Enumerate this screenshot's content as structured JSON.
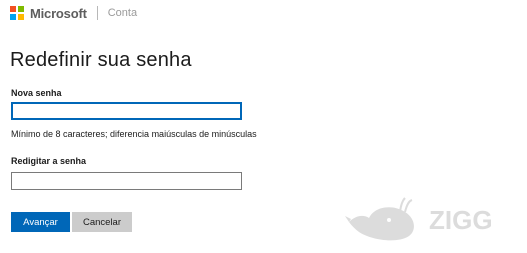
{
  "header": {
    "brand": "Microsoft",
    "section": "Conta",
    "logo_colors": [
      "#f25022",
      "#7fba00",
      "#00a4ef",
      "#ffb900"
    ]
  },
  "page": {
    "title": "Redefinir sua senha"
  },
  "form": {
    "new_password_label": "Nova senha",
    "new_password_value": "",
    "hint": "Mínimo de 8 caracteres; diferencia maiúsculas de minúsculas",
    "confirm_password_label": "Redigitar a senha",
    "confirm_password_value": ""
  },
  "buttons": {
    "next_label": "Avançar",
    "cancel_label": "Cancelar"
  },
  "watermark": {
    "text": "ZIGG",
    "icon": "whale-icon"
  },
  "colors": {
    "accent": "#0067b8",
    "secondary_button": "#cccccc",
    "watermark": "#dcdcdc"
  }
}
